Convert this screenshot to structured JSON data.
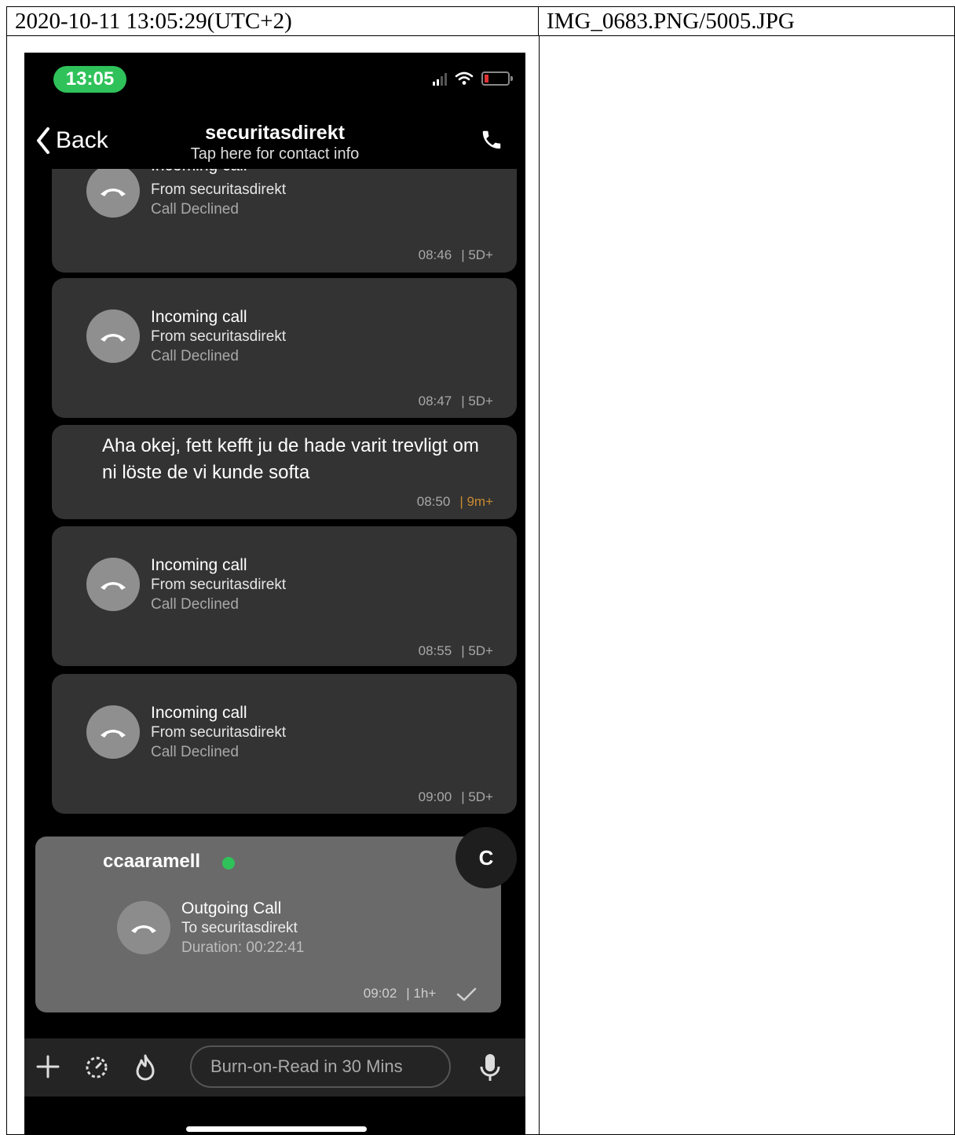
{
  "report": {
    "timestamp": "2020-10-11 13:05:29(UTC+2)",
    "filename": "IMG_0683.PNG/5005.JPG"
  },
  "status_bar": {
    "time": "13:05"
  },
  "header": {
    "back_label": "Back",
    "contact_name": "securitasdirekt",
    "contact_sub": "Tap here for contact info"
  },
  "messages": [
    {
      "type": "call",
      "title": "Incoming call",
      "line2": "From securitasdirekt",
      "line3": "Call Declined",
      "time": "08:46",
      "expiry": "| 5D+"
    },
    {
      "type": "call",
      "title": "Incoming call",
      "line2": "From securitasdirekt",
      "line3": "Call Declined",
      "time": "08:47",
      "expiry": "| 5D+"
    },
    {
      "type": "text",
      "text": "Aha okej, fett kefft ju de hade varit trevligt om ni löste de vi kunde softa",
      "time": "08:50",
      "expiry": "| 9m+"
    },
    {
      "type": "call",
      "title": "Incoming call",
      "line2": "From securitasdirekt",
      "line3": "Call Declined",
      "time": "08:55",
      "expiry": "| 5D+"
    },
    {
      "type": "call",
      "title": "Incoming call",
      "line2": "From securitasdirekt",
      "line3": "Call Declined",
      "time": "09:00",
      "expiry": "| 5D+"
    }
  ],
  "sent_message": {
    "sender": "ccaaramell",
    "avatar_letter": "C",
    "title": "Outgoing Call",
    "line2": "To securitasdirekt",
    "line3": "Duration: 00:22:41",
    "time": "09:02",
    "expiry": "| 1h+"
  },
  "composer": {
    "placeholder": "Burn-on-Read in 30 Mins"
  },
  "colors": {
    "online": "#2fc25a",
    "accent_orange": "#c98a2e",
    "bubble": "#333333",
    "sent_bubble": "#6a6a6a"
  },
  "icons": [
    "back-chevron-icon",
    "phone-icon",
    "call-declined-icon",
    "check-icon",
    "plus-icon",
    "timer-icon",
    "fire-icon",
    "microphone-icon"
  ]
}
